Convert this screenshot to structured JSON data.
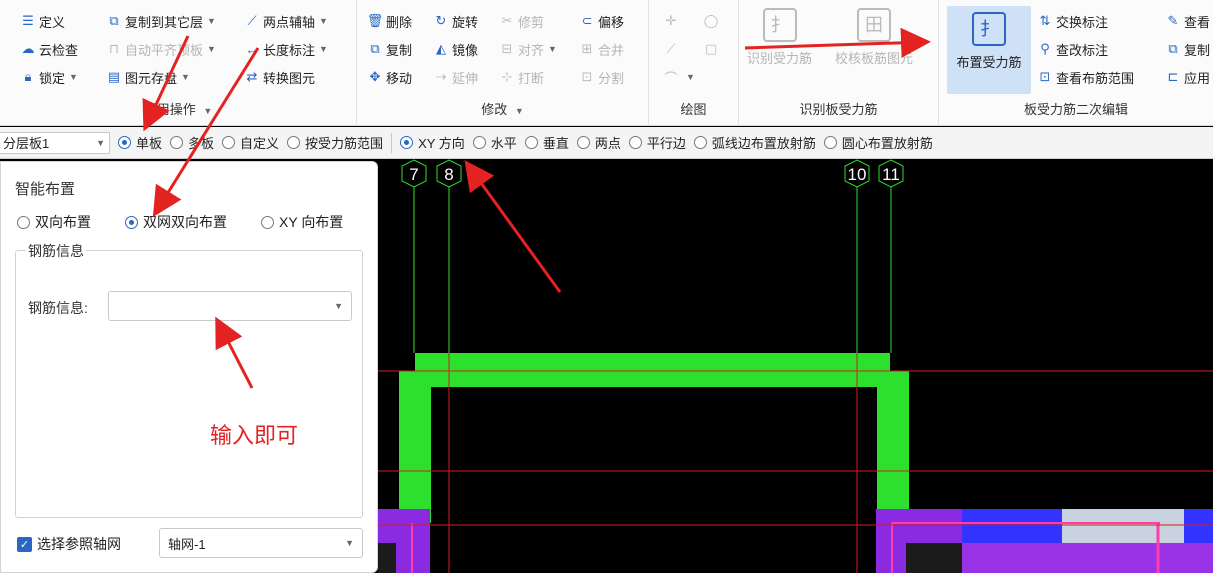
{
  "ribbon": {
    "general": {
      "label": "通用操作",
      "define": "定义",
      "cloud_check": "云检查",
      "lock": "锁定",
      "copy_other_floor": "复制到其它层",
      "auto_align": "自动平齐顶板",
      "save_element": "图元存盘",
      "two_point_axis": "两点辅轴",
      "length_mark": "长度标注",
      "convert_element": "转换图元"
    },
    "modify": {
      "label": "修改",
      "delete": "删除",
      "rotate": "旋转",
      "trim": "修剪",
      "offset": "偏移",
      "copy": "复制",
      "mirror": "镜像",
      "align": "对齐",
      "merge": "合并",
      "move": "移动",
      "extend": "延伸",
      "break": "打断",
      "split": "分割"
    },
    "draw": {
      "label": "绘图"
    },
    "identify": {
      "label": "识别板受力筋",
      "identify_btn": "识别受力筋",
      "check_btn": "校核板筋图元"
    },
    "secondary": {
      "label": "板受力筋二次编辑",
      "layout_btn": "布置受力筋",
      "swap_mark": "交换标注",
      "check_mark": "查改标注",
      "view_range": "查看布筋范围",
      "view": "查看",
      "copy": "复制",
      "apply": "应用"
    }
  },
  "optbar": {
    "layer_select": "分层板1",
    "options": [
      "单板",
      "多板",
      "自定义",
      "按受力筋范围"
    ],
    "selected_option": 0,
    "dir_options": [
      "XY 方向",
      "水平",
      "垂直",
      "两点",
      "平行边",
      "弧线边布置放射筋",
      "圆心布置放射筋"
    ],
    "selected_dir": 0
  },
  "panel": {
    "title": "智能布置",
    "modes": [
      "双向布置",
      "双网双向布置",
      "XY 向布置"
    ],
    "selected_mode": 1,
    "group_title": "钢筋信息",
    "rebar_label": "钢筋信息:",
    "rebar_value": "",
    "ref_axis_label": "选择参照轴网",
    "ref_axis_checked": true,
    "axis_value": "轴网-1"
  },
  "canvas": {
    "axis_labels": [
      "7",
      "8",
      "10",
      "11"
    ]
  },
  "annotation": {
    "note": "输入即可"
  },
  "colors": {
    "slab": "#2ee02e",
    "beam_purple": "#8a2be2",
    "grid_red": "#d21e1e",
    "annotation": "#e32222",
    "accent": "#2a66c2"
  }
}
